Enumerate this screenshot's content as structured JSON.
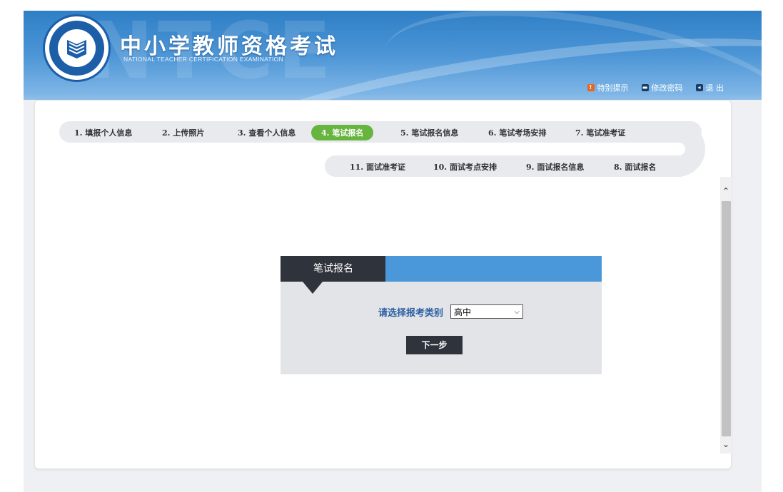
{
  "header": {
    "title": "中小学教师资格考试",
    "subtitle": "NATIONAL TEACHER CERTIFICATION EXAMINATION",
    "bg_letters": "NTCE",
    "links": [
      {
        "label": "特别提示",
        "icon": "warning-icon"
      },
      {
        "label": "修改密码",
        "icon": "key-icon"
      },
      {
        "label": "退 出",
        "icon": "exit-icon"
      }
    ]
  },
  "steps": {
    "row1": [
      "1. 填报个人信息",
      "2. 上传照片",
      "3. 查看个人信息",
      "4. 笔试报名",
      "5. 笔试报名信息",
      "6. 笔试考场安排",
      "7. 笔试准考证"
    ],
    "row2": [
      "11. 面试准考证",
      "10. 面试考点安排",
      "9. 面试报名信息",
      "8. 面试报名"
    ],
    "active": "4. 笔试报名"
  },
  "form": {
    "card_title": "笔试报名",
    "label": "请选择报考类别",
    "selected_category": "高中",
    "next_label": "下一步"
  },
  "colors": {
    "header_blue": "#4c95d6",
    "active_step": "#67b43f",
    "card_dark": "#2f333b",
    "card_blue": "#4a97d9",
    "label_blue": "#2b5fa3"
  }
}
